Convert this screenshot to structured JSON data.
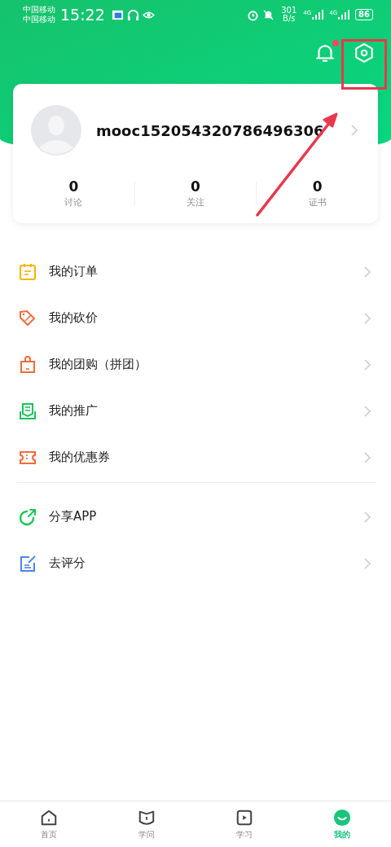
{
  "status_bar": {
    "carriers": [
      "中国移动",
      "中国移动"
    ],
    "time": "15:22",
    "speed_value": "301",
    "speed_unit": "B/s",
    "network_labels": [
      "4G",
      "4G"
    ],
    "battery": "86"
  },
  "header": {
    "notification_badge": true
  },
  "profile": {
    "username": "mooc152054320786496306",
    "stats": [
      {
        "value": "0",
        "label": "讨论"
      },
      {
        "value": "0",
        "label": "关注"
      },
      {
        "value": "0",
        "label": "证书"
      }
    ]
  },
  "menu_groups": [
    [
      {
        "kind": "order",
        "label": "我的订单",
        "color": "#f7b500"
      },
      {
        "kind": "bargain",
        "label": "我的砍价",
        "color": "#f26b3a"
      },
      {
        "kind": "group",
        "label": "我的团购（拼团）",
        "color": "#f26b3a"
      },
      {
        "kind": "promote",
        "label": "我的推广",
        "color": "#1bc45a"
      },
      {
        "kind": "coupon",
        "label": "我的优惠券",
        "color": "#f26b3a"
      }
    ],
    [
      {
        "kind": "share",
        "label": "分享APP",
        "color": "#1bc45a"
      },
      {
        "kind": "rate",
        "label": "去评分",
        "color": "#4a86e8"
      }
    ]
  ],
  "tabs": [
    {
      "kind": "home",
      "label": "首页",
      "selected": false
    },
    {
      "kind": "learn",
      "label": "学问",
      "selected": false
    },
    {
      "kind": "study",
      "label": "学习",
      "selected": false
    },
    {
      "kind": "mine",
      "label": "我的",
      "selected": true
    }
  ]
}
